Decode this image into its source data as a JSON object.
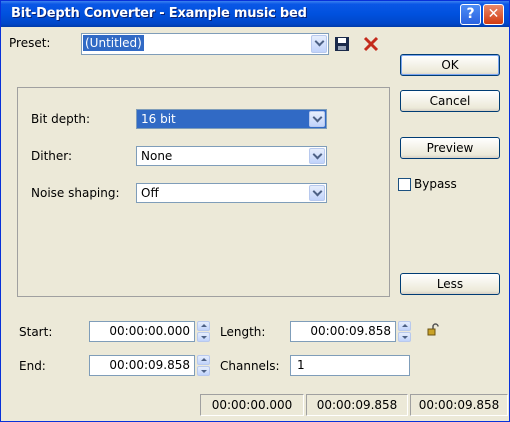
{
  "window": {
    "title": "Bit-Depth Converter - Example music bed"
  },
  "preset": {
    "label": "Preset:",
    "value": "(Untitled)"
  },
  "settings": {
    "bit_depth": {
      "label": "Bit depth:",
      "value": "16 bit"
    },
    "dither": {
      "label": "Dither:",
      "value": "None"
    },
    "noise_shaping": {
      "label": "Noise shaping:",
      "value": "Off"
    }
  },
  "buttons": {
    "ok": "OK",
    "cancel": "Cancel",
    "preview": "Preview",
    "less": "Less"
  },
  "bypass": {
    "label": "Bypass",
    "checked": false
  },
  "selection": {
    "start_label": "Start:",
    "start": "00:00:00.000",
    "length_label": "Length:",
    "length": "00:00:09.858",
    "end_label": "End:",
    "end": "00:00:09.858",
    "channels_label": "Channels:",
    "channels": "1"
  },
  "statusbar": {
    "start": "00:00:00.000",
    "end": "00:00:09.858",
    "length": "00:00:09.858"
  },
  "icons": {
    "help": "help-icon",
    "close": "close-icon",
    "save": "save-preset-icon",
    "delete": "delete-preset-icon",
    "lock": "lock-icon"
  }
}
